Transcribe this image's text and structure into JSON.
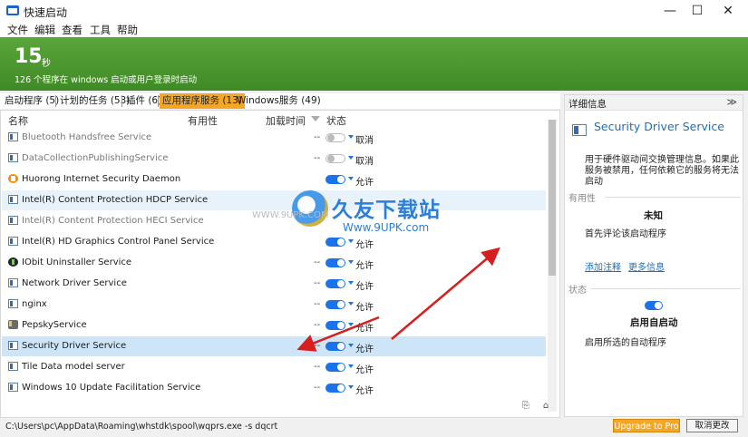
{
  "window": {
    "title": "快速启动",
    "min": "—",
    "max": "☐",
    "close": "✕"
  },
  "menu": [
    "文件",
    "编辑",
    "查看",
    "工具",
    "帮助"
  ],
  "banner": {
    "count": "15",
    "unit": "秒",
    "subtitle": "126 个程序在 windows 启动或用户登录时启动"
  },
  "tabs": [
    {
      "label": "启动程序 (5)"
    },
    {
      "label": "计划的任务 (53)"
    },
    {
      "label": "插件 (6)"
    },
    {
      "label": "应用程序服务 (13)"
    },
    {
      "label": "Windows服务 (49)"
    }
  ],
  "columns": {
    "name": "名称",
    "usefulness": "有用性",
    "load_time": "加载时间",
    "status": "状态"
  },
  "rows": [
    {
      "name": "Bluetooth Handsfree Service",
      "dash": "--",
      "status": "取消",
      "enabled": false
    },
    {
      "name": "DataCollectionPublishingService",
      "dash": "--",
      "status": "取消",
      "enabled": false
    },
    {
      "name": "Huorong Internet Security Daemon",
      "dash": "",
      "status": "允许",
      "enabled": true,
      "icon": "huorong-shield-icon"
    },
    {
      "name": "Intel(R) Content Protection HDCP Service",
      "dash": "",
      "status": "",
      "enabled": true
    },
    {
      "name": "Intel(R) Content Protection HECI Service",
      "dash": "",
      "status": "",
      "enabled": true
    },
    {
      "name": "Intel(R) HD Graphics Control Panel Service",
      "dash": "",
      "status": "允许",
      "enabled": true
    },
    {
      "name": "IObit Uninstaller Service",
      "dash": "--",
      "status": "允许",
      "enabled": true,
      "icon": "iobit-icon"
    },
    {
      "name": "Network Driver Service",
      "dash": "--",
      "status": "允许",
      "enabled": true
    },
    {
      "name": "nginx",
      "dash": "--",
      "status": "允许",
      "enabled": true
    },
    {
      "name": "PepskyService",
      "dash": "--",
      "status": "允许",
      "enabled": true,
      "icon": "pepsky-icon"
    },
    {
      "name": "Security Driver Service",
      "dash": "--",
      "status": "允许",
      "enabled": true
    },
    {
      "name": "Tile Data model server",
      "dash": "--",
      "status": "允许",
      "enabled": true
    },
    {
      "name": "Windows 10 Update Facilitation Service",
      "dash": "--",
      "status": "允许",
      "enabled": true
    }
  ],
  "status_path": "C:\\Users\\pc\\AppData\\Roaming\\whstdk\\spool\\wqprs.exe -s dqcrt",
  "buttons": {
    "upgrade": "Upgrade to Pro",
    "cancel": "取消更改"
  },
  "detail": {
    "header": "详细信息",
    "collapse": "≫",
    "title": "Security Driver Service",
    "description": "用于硬件驱动间交换管理信息。如果此服务被禁用，任何依赖它的服务将无法启动",
    "usefulness_label": "有用性",
    "usefulness_value": "未知",
    "usefulness_note": "首先评论该启动程序",
    "link_comment": "添加注释",
    "link_more": "更多信息",
    "status_label": "状态",
    "status_value": "启用自启动",
    "status_note": "启用所选的自动程序"
  },
  "watermark": {
    "main": "久友下载站",
    "url_left": "WWW.9UPK.COM",
    "url_right": "Www.9UPK.com"
  },
  "colors": {
    "banner": "#4a9a2e",
    "accent": "#f5a623",
    "link": "#1f6fb8",
    "toggle_on": "#1a73e8",
    "arrow": "#d62020"
  }
}
